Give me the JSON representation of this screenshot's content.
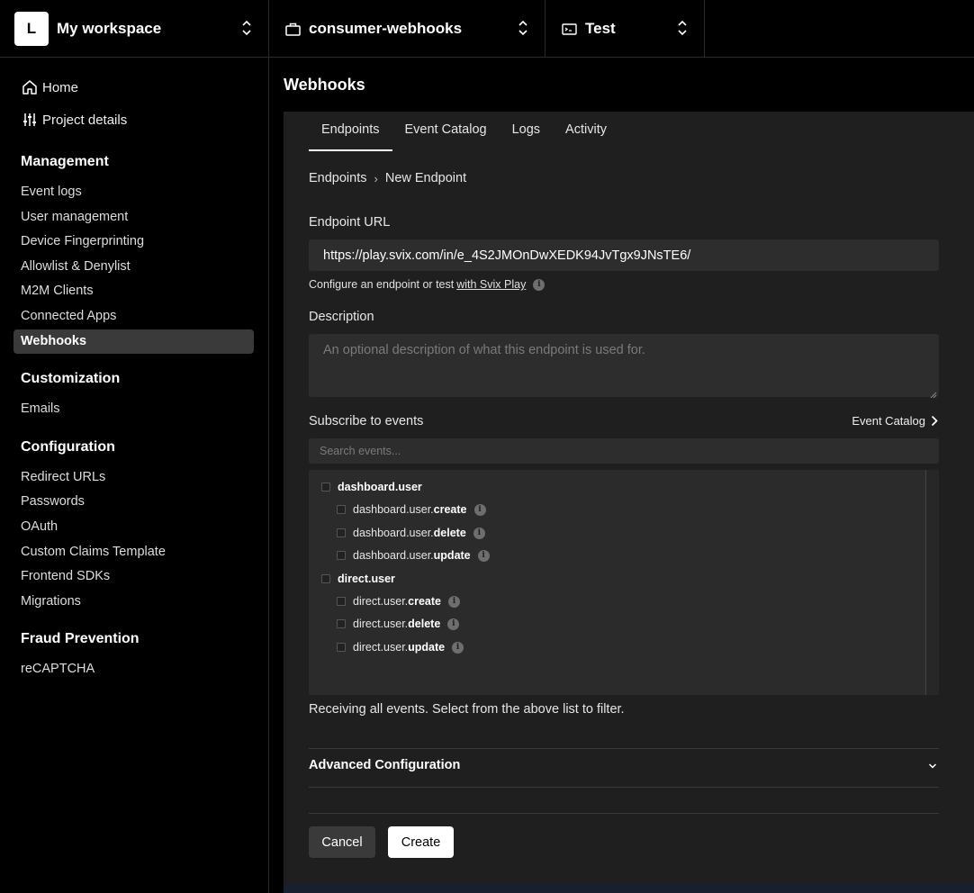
{
  "topbar": {
    "workspace_initial": "L",
    "workspace_name": "My workspace",
    "project_name": "consumer-webhooks",
    "environment_name": "Test"
  },
  "sidebar": {
    "top_items": [
      {
        "label": "Home",
        "icon": "home-icon"
      },
      {
        "label": "Project details",
        "icon": "sliders-icon"
      }
    ],
    "sections": [
      {
        "title": "Management",
        "items": [
          "Event logs",
          "User management",
          "Device Fingerprinting",
          "Allowlist & Denylist",
          "M2M Clients",
          "Connected Apps",
          "Webhooks"
        ]
      },
      {
        "title": "Customization",
        "items": [
          "Emails"
        ]
      },
      {
        "title": "Configuration",
        "items": [
          "Redirect URLs",
          "Passwords",
          "OAuth",
          "Custom Claims Template",
          "Frontend SDKs",
          "Migrations"
        ]
      },
      {
        "title": "Fraud Prevention",
        "items": [
          "reCAPTCHA"
        ]
      }
    ],
    "active_item": "Webhooks"
  },
  "main": {
    "title": "Webhooks",
    "tabs": [
      "Endpoints",
      "Event Catalog",
      "Logs",
      "Activity"
    ],
    "active_tab": "Endpoints",
    "breadcrumb": [
      "Endpoints",
      "New Endpoint"
    ],
    "endpoint_url_label": "Endpoint URL",
    "endpoint_url_value": "https://play.svix.com/in/e_4S2JMOnDwXEDK94JvTgx9JNsTE6/",
    "hint_text": "Configure an endpoint or test",
    "hint_link": "with Svix Play",
    "description_label": "Description",
    "description_placeholder": "An optional description of what this endpoint is used for.",
    "subscribe_label": "Subscribe to events",
    "event_catalog_link": "Event Catalog",
    "search_placeholder": "Search events...",
    "event_groups": [
      {
        "group": "dashboard.user",
        "events": [
          {
            "prefix": "dashboard.user.",
            "action": "create"
          },
          {
            "prefix": "dashboard.user.",
            "action": "delete"
          },
          {
            "prefix": "dashboard.user.",
            "action": "update"
          }
        ]
      },
      {
        "group": "direct.user",
        "events": [
          {
            "prefix": "direct.user.",
            "action": "create"
          },
          {
            "prefix": "direct.user.",
            "action": "delete"
          },
          {
            "prefix": "direct.user.",
            "action": "update"
          }
        ]
      }
    ],
    "receiving_text": "Receiving all events. Select from the above list to filter.",
    "advanced_label": "Advanced Configuration",
    "cancel_label": "Cancel",
    "create_label": "Create"
  }
}
